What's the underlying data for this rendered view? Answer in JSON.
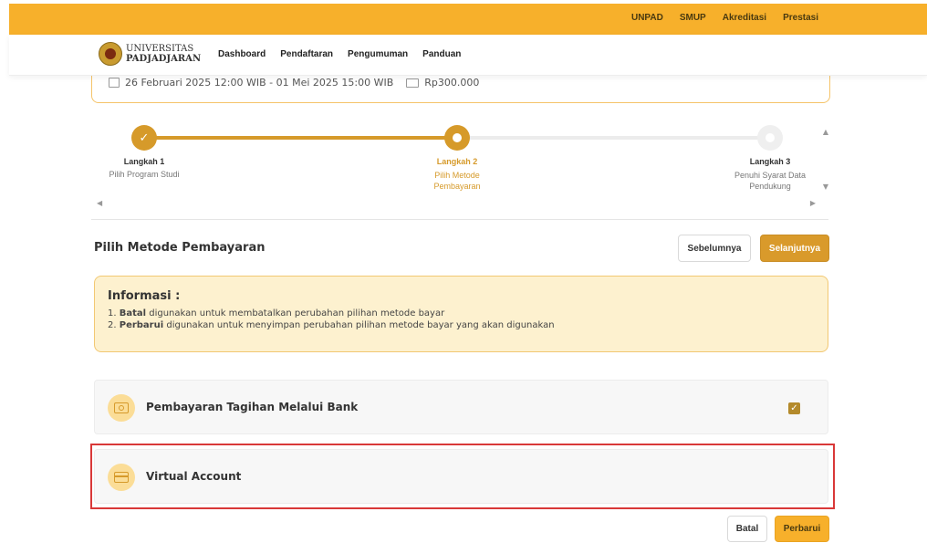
{
  "topbar": {
    "links": [
      "UNPAD",
      "SMUP",
      "Akreditasi",
      "Prestasi"
    ]
  },
  "navbar": {
    "logo_line1": "UNIVERSITAS",
    "logo_line2": "PADJADJARAN",
    "menu": [
      "Dashboard",
      "Pendaftaran",
      "Pengumuman",
      "Panduan"
    ]
  },
  "info_card": {
    "period": "26 Februari 2025 12:00 WIB - 01 Mei 2025 15:00 WIB",
    "fee": "Rp300.000"
  },
  "stepper": {
    "steps": [
      {
        "title": "Langkah 1",
        "desc": "Pilih Program Studi",
        "status": "completed"
      },
      {
        "title": "Langkah 2",
        "desc": "Pilih Metode Pembayaran",
        "status": "active"
      },
      {
        "title": "Langkah 3",
        "desc": "Penuhi Syarat Data Pendukung",
        "status": "pending"
      }
    ]
  },
  "section": {
    "title": "Pilih Metode Pembayaran",
    "prev_label": "Sebelumnya",
    "next_label": "Selanjutnya"
  },
  "info_alert": {
    "title": "Informasi :",
    "items": [
      {
        "num": "1.",
        "bold": "Batal",
        "text": " digunakan untuk membatalkan perubahan pilihan metode bayar"
      },
      {
        "num": "2.",
        "bold": "Perbarui",
        "text": " digunakan untuk menyimpan perubahan pilihan metode bayar yang akan digunakan"
      }
    ]
  },
  "payment_options": [
    {
      "label": "Pembayaran Tagihan Melalui Bank",
      "icon": "bill-icon",
      "checked": true
    },
    {
      "label": "Virtual Account",
      "icon": "card-icon",
      "checked": false
    }
  ],
  "footer": {
    "cancel_label": "Batal",
    "update_label": "Perbarui"
  },
  "colors": {
    "accent": "#f7b02b",
    "primary": "#d99a2b",
    "highlight": "#d93838"
  }
}
